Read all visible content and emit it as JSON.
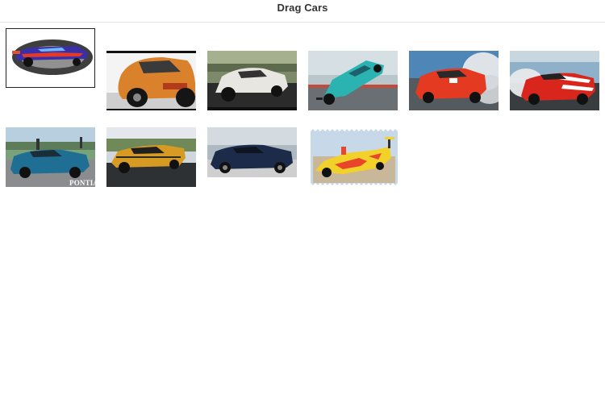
{
  "page": {
    "title": "Drag Cars"
  },
  "thumbnails": [
    {
      "name": "drag-car-thumbnail-1",
      "subject": "purple-blue-funny-car",
      "colors": {
        "body": "#3b2fa8",
        "accent": "#e23a2a"
      }
    },
    {
      "name": "drag-car-thumbnail-2",
      "subject": "orange-coupe-rear",
      "colors": {
        "body": "#d9822b"
      }
    },
    {
      "name": "drag-car-thumbnail-3",
      "subject": "white-coupe-wheelie",
      "colors": {
        "body": "#e8e6e1"
      }
    },
    {
      "name": "drag-car-thumbnail-4",
      "subject": "teal-car-wheelie",
      "colors": {
        "body": "#2ab3b0"
      }
    },
    {
      "name": "drag-car-thumbnail-5",
      "subject": "red-camaro-burnout",
      "colors": {
        "body": "#e43a22"
      }
    },
    {
      "name": "drag-car-thumbnail-6",
      "subject": "red-white-car-burnout",
      "colors": {
        "body": "#d8261c"
      }
    },
    {
      "name": "drag-car-thumbnail-7",
      "subject": "blue-pontiac",
      "colors": {
        "body": "#1f6f95"
      },
      "watermark": "PONTIAC"
    },
    {
      "name": "drag-car-thumbnail-8",
      "subject": "gold-chevelle-wheelie",
      "colors": {
        "body": "#d79a22"
      }
    },
    {
      "name": "drag-car-thumbnail-9",
      "subject": "dark-blue-camaro",
      "colors": {
        "body": "#1c2b4a"
      }
    },
    {
      "name": "drag-car-thumbnail-10",
      "subject": "yellow-funny-car",
      "colors": {
        "body": "#f2d22a",
        "accent": "#e8452a"
      }
    }
  ]
}
